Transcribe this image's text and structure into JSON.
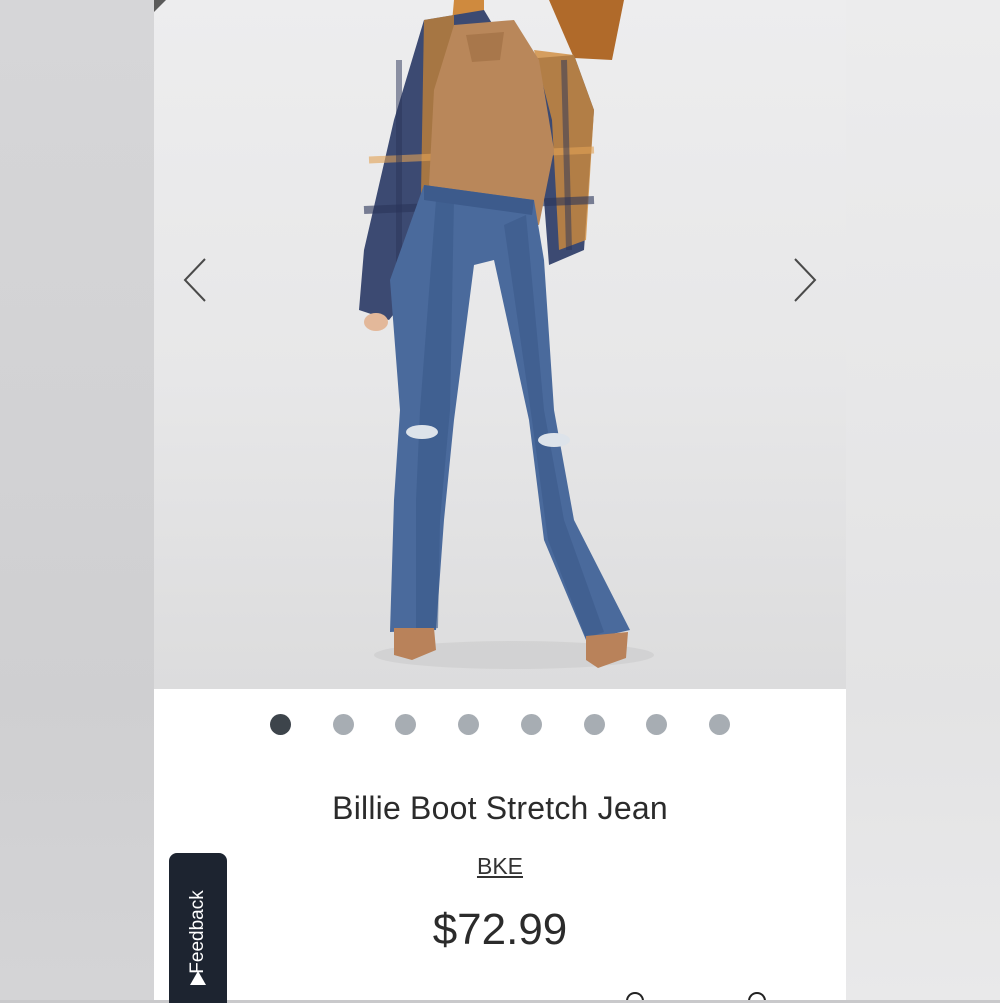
{
  "product": {
    "title": "Billie Boot Stretch Jean",
    "brand": "BKE",
    "price": "$72.99"
  },
  "gallery": {
    "prev_icon": "chevron-left-icon",
    "next_icon": "chevron-right-icon",
    "image_count": 8,
    "active_index": 0
  },
  "feedback": {
    "label": "Feedback",
    "icon": "triangle-up-icon"
  },
  "colors": {
    "active_dot": "#3d444b",
    "inactive_dot": "#a7adb3",
    "feedback_bg": "#1d2430",
    "text": "#2b2b2b"
  }
}
